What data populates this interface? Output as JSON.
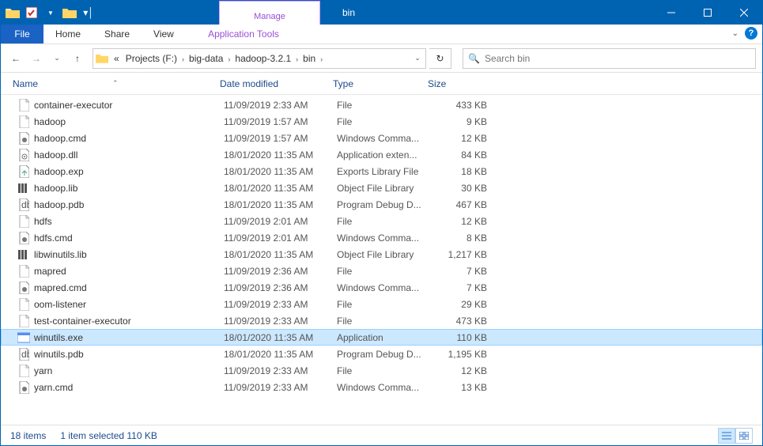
{
  "title": "bin",
  "ribbon": {
    "file": "File",
    "home": "Home",
    "share": "Share",
    "view": "View",
    "manage": "Manage",
    "app_tools": "Application Tools"
  },
  "breadcrumbs": [
    "Projects (F:)",
    "big-data",
    "hadoop-3.2.1",
    "bin"
  ],
  "search_placeholder": "Search bin",
  "columns": {
    "name": "Name",
    "date": "Date modified",
    "type": "Type",
    "size": "Size"
  },
  "files": [
    {
      "icon": "file",
      "name": "container-executor",
      "date": "11/09/2019 2:33 AM",
      "type": "File",
      "size": "433 KB",
      "sel": false
    },
    {
      "icon": "file",
      "name": "hadoop",
      "date": "11/09/2019 1:57 AM",
      "type": "File",
      "size": "9 KB",
      "sel": false
    },
    {
      "icon": "cmd",
      "name": "hadoop.cmd",
      "date": "11/09/2019 1:57 AM",
      "type": "Windows Comma...",
      "size": "12 KB",
      "sel": false
    },
    {
      "icon": "dll",
      "name": "hadoop.dll",
      "date": "18/01/2020 11:35 AM",
      "type": "Application exten...",
      "size": "84 KB",
      "sel": false
    },
    {
      "icon": "exp",
      "name": "hadoop.exp",
      "date": "18/01/2020 11:35 AM",
      "type": "Exports Library File",
      "size": "18 KB",
      "sel": false
    },
    {
      "icon": "lib",
      "name": "hadoop.lib",
      "date": "18/01/2020 11:35 AM",
      "type": "Object File Library",
      "size": "30 KB",
      "sel": false
    },
    {
      "icon": "pdb",
      "name": "hadoop.pdb",
      "date": "18/01/2020 11:35 AM",
      "type": "Program Debug D...",
      "size": "467 KB",
      "sel": false
    },
    {
      "icon": "file",
      "name": "hdfs",
      "date": "11/09/2019 2:01 AM",
      "type": "File",
      "size": "12 KB",
      "sel": false
    },
    {
      "icon": "cmd",
      "name": "hdfs.cmd",
      "date": "11/09/2019 2:01 AM",
      "type": "Windows Comma...",
      "size": "8 KB",
      "sel": false
    },
    {
      "icon": "lib",
      "name": "libwinutils.lib",
      "date": "18/01/2020 11:35 AM",
      "type": "Object File Library",
      "size": "1,217 KB",
      "sel": false
    },
    {
      "icon": "file",
      "name": "mapred",
      "date": "11/09/2019 2:36 AM",
      "type": "File",
      "size": "7 KB",
      "sel": false
    },
    {
      "icon": "cmd",
      "name": "mapred.cmd",
      "date": "11/09/2019 2:36 AM",
      "type": "Windows Comma...",
      "size": "7 KB",
      "sel": false
    },
    {
      "icon": "file",
      "name": "oom-listener",
      "date": "11/09/2019 2:33 AM",
      "type": "File",
      "size": "29 KB",
      "sel": false
    },
    {
      "icon": "file",
      "name": "test-container-executor",
      "date": "11/09/2019 2:33 AM",
      "type": "File",
      "size": "473 KB",
      "sel": false
    },
    {
      "icon": "exe",
      "name": "winutils.exe",
      "date": "18/01/2020 11:35 AM",
      "type": "Application",
      "size": "110 KB",
      "sel": true
    },
    {
      "icon": "pdb",
      "name": "winutils.pdb",
      "date": "18/01/2020 11:35 AM",
      "type": "Program Debug D...",
      "size": "1,195 KB",
      "sel": false
    },
    {
      "icon": "file",
      "name": "yarn",
      "date": "11/09/2019 2:33 AM",
      "type": "File",
      "size": "12 KB",
      "sel": false
    },
    {
      "icon": "cmd",
      "name": "yarn.cmd",
      "date": "11/09/2019 2:33 AM",
      "type": "Windows Comma...",
      "size": "13 KB",
      "sel": false
    }
  ],
  "status": {
    "count": "18 items",
    "selection": "1 item selected  110 KB"
  }
}
